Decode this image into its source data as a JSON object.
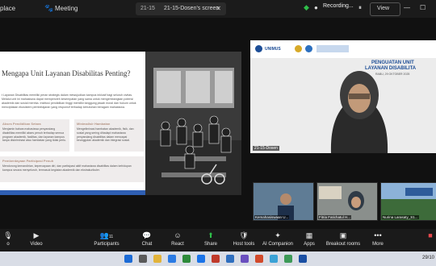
{
  "topbar": {
    "app_partial": "place",
    "meeting_label": "Meeting",
    "screen_number": "21-15",
    "screen_label": "21-15-Dosen's screen",
    "recording_label": "Recording...",
    "view_label": "View"
  },
  "slide": {
    "title": "Mengapa Unit Layanan Disabilitas Penting?",
    "intro": "t Layanan Disabilitas memiliki peran strategis dalam mewujudkan kampus inklusif bagi seluruh civitas. Melalui unit ini mahasiswa dapat memperoleh kesempatan yang sama untuk mengembangkan potensi akademik dan sosial mereka. Institusi pendidikan tinggi memiliki tanggung jawab moral dan hukum untuk menciptakan ekosistem pembelajaran yang responsif terhadap kebutuhan beragam mahasiswa.",
    "box1_title": "Akses Pendidikan Setara",
    "box1_text": "Menjamin bahwa mahasiswa penyandang disabilitas memiliki akses penuh terhadap semua program akademik, fasilitas, dan layanan kampus tanpa diskriminasi atau hambatan yang tidak perlu.",
    "box2_title": "Minimalisir Hambatan",
    "box2_text": "Mengeliminasi hambatan akademik, fisik, dan sosial yang sering dihadapi mahasiswa penyandang disabilitas dalam mencapai keunggulan akademik dan integrasi sosial.",
    "box3_title": "Pemberdayaan Partisipasi Penuh",
    "box3_text": "Mendorong kemandirian, kepercayaan diri, dan partisipasi aktif mahasiswa disabilitas dalam kehidupan kampus secara menyeluruh, termasuk kegiatan akademik dan ekstrakurikuler."
  },
  "speaker": {
    "logo_text": "UNIMUS",
    "title_line1": "PENGUATAN UNIT",
    "title_line2": "LAYANAN DISABILITA",
    "date": "RABU, 29 OKTOBER 2025",
    "name": "21-15-Dosen"
  },
  "thumbnails": [
    {
      "name": "Kemahasiswaan U..."
    },
    {
      "name": "Fitria Fatichatul H..."
    },
    {
      "name": "Nurina Larasaty_S1..."
    }
  ],
  "toolbar": [
    {
      "label": "o",
      "icon": "mic-icon"
    },
    {
      "label": "Video",
      "icon": "video-icon"
    },
    {
      "label": "Participants",
      "icon": "participants-icon",
      "count": "11"
    },
    {
      "label": "Chat",
      "icon": "chat-icon"
    },
    {
      "label": "React",
      "icon": "react-icon"
    },
    {
      "label": "Share",
      "icon": "share-icon"
    },
    {
      "label": "Host tools",
      "icon": "shield-icon"
    },
    {
      "label": "AI Companion",
      "icon": "ai-icon"
    },
    {
      "label": "Apps",
      "icon": "apps-icon"
    },
    {
      "label": "Breakout rooms",
      "icon": "breakout-icon"
    },
    {
      "label": "More",
      "icon": "more-icon"
    }
  ],
  "taskbar": {
    "clock": "29/10"
  },
  "colors": {
    "share_green": "#2fbf4a",
    "accent_blue": "#1c4d96",
    "slide_footer_blue": "#2f5fb3"
  }
}
